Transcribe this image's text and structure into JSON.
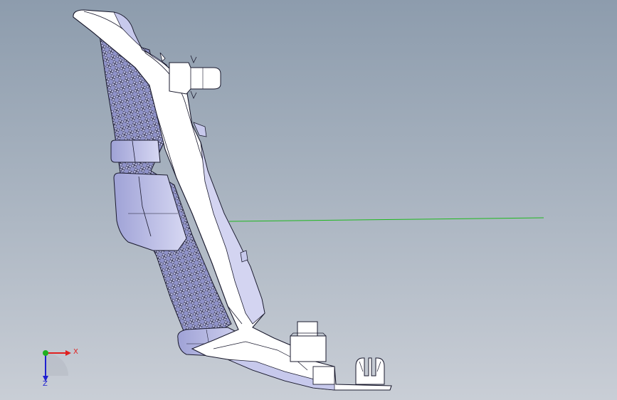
{
  "viewport": {
    "background_top": "#8d9cad",
    "background_bottom": "#c9ced6",
    "model_body_color": "#ffffff",
    "model_shade_color": "#c7c9ec",
    "model_edge_color": "#1a1a2e",
    "sketch_line_color": "#1fb81f"
  },
  "triad": {
    "x_label": "X",
    "z_label": "Z",
    "x_color": "#e02020",
    "y_color": "#20b020",
    "z_color": "#2020d0"
  },
  "model": {
    "name_icon": "molded-part-model",
    "features": [
      "ribbed-lattice",
      "connector-housing",
      "mounting-clip",
      "side-tabs"
    ]
  }
}
